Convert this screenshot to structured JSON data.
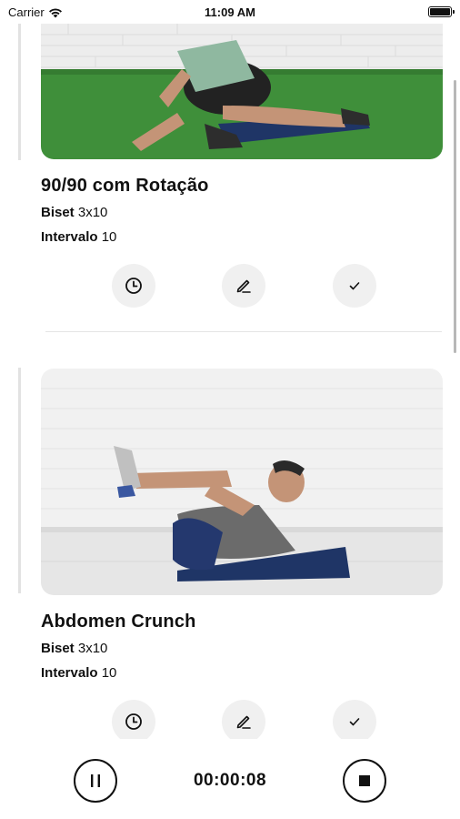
{
  "status_bar": {
    "carrier": "Carrier",
    "time": "11:09 AM",
    "battery_level": 1.0
  },
  "exercises": [
    {
      "title": "90/90 com Rotação",
      "set_label": "Biset",
      "set_value": "3x10",
      "interval_label": "Intervalo",
      "interval_value": "10",
      "image_icon": "exercise-photo-90-90-rotation"
    },
    {
      "title": "Abdomen Crunch",
      "set_label": "Biset",
      "set_value": "3x10",
      "interval_label": "Intervalo",
      "interval_value": "10",
      "image_icon": "exercise-photo-abdomen-crunch"
    }
  ],
  "actions": [
    "clock-icon",
    "pencil-icon",
    "checkmark-icon"
  ],
  "player": {
    "elapsed": "00:00:08",
    "pause_icon": "pause-icon",
    "stop_icon": "stop-icon"
  },
  "colors": {
    "action_bg": "#f0f0f0",
    "grass": "#3f8f3a",
    "mat": "#1f3566"
  }
}
